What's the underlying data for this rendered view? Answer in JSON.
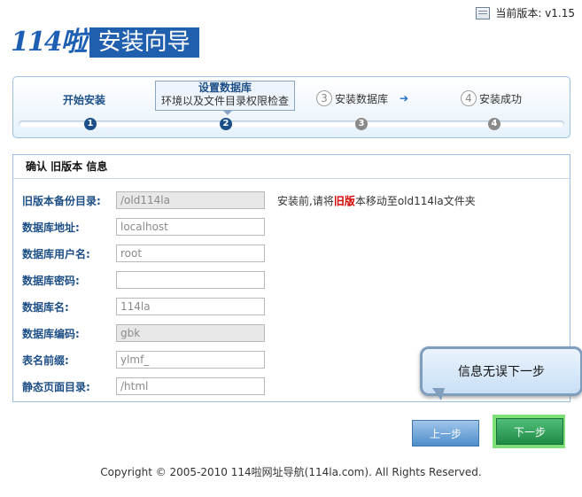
{
  "header": {
    "version_label": "当前版本: v1.15",
    "logo_text": "114啦",
    "title": "安装向导"
  },
  "steps": {
    "step1": "开始安装",
    "step2_title": "设置数据库",
    "step2_sub": "环境以及文件目录权限检查",
    "step3_num": "3",
    "step3": "安装数据库",
    "step4_num": "4",
    "step4": "安装成功",
    "dots": [
      "1",
      "2",
      "3",
      "4"
    ],
    "current": 2
  },
  "form": {
    "section_title": "确认 旧版本 信息",
    "fields": [
      {
        "label": "旧版本备份目录:",
        "value": "/old114la",
        "readonly": true
      },
      {
        "label": "数据库地址:",
        "value": "localhost",
        "readonly": false
      },
      {
        "label": "数据库用户名:",
        "value": "root",
        "readonly": false
      },
      {
        "label": "数据库密码:",
        "value": "",
        "readonly": false
      },
      {
        "label": "数据库名:",
        "value": "114la",
        "readonly": false
      },
      {
        "label": "数据库编码:",
        "value": "gbk",
        "readonly": true
      },
      {
        "label": "表名前缀:",
        "value": "ylmf_",
        "readonly": false
      },
      {
        "label": "静态页面目录:",
        "value": "/html",
        "readonly": false
      }
    ],
    "hint_before": "安装前,请将",
    "hint_bold": "旧版",
    "hint_after": "本移动至old114la文件夹"
  },
  "tooltip": "信息无误下一步",
  "buttons": {
    "prev": "上一步",
    "next": "下一步"
  },
  "footer": "Copyright © 2005-2010 114啦网址导航(114la.com). All Rights Reserved.",
  "colors": {
    "brand_blue": "#1f5fae",
    "step_active": "#1c4f8a",
    "hint_red": "#d40000",
    "next_green": "#1f8a46"
  }
}
